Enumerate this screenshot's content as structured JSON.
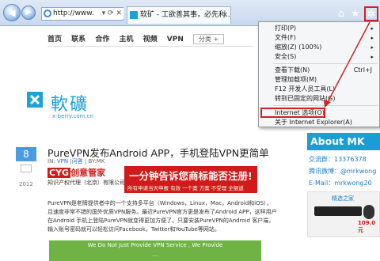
{
  "browser": {
    "address": "http://www.x-be...",
    "address_tools": "▾ ⟳ ✕",
    "tab_title": "软矿 - 工欲善其事，必先利...",
    "tab_close": "×"
  },
  "site": {
    "nav": [
      "首页",
      "联系",
      "合作",
      "主机",
      "视频",
      "VPN"
    ],
    "category_label": "分类 +",
    "logo_name": "軟礦",
    "logo_url": "x-berry.com.cn"
  },
  "post": {
    "day": "8",
    "year": "2012",
    "title": "PureVPN发布Android APP，手机登陆VPN更简单",
    "meta_in": "IN: ",
    "meta_category": "VPN",
    "meta_sep": " |",
    "meta_link2": "问答 ",
    "meta_by": "| BY:MK",
    "body": "PureVPN是老牌提供者中的一个支持多平台（Windows，Linux，Mac，Android和iOS），且速度非常不错的国外优质VPN服务。最近PureVPN官方更是发布了Android APP，这样用户在Android 手机上登陆PureVPN就变得更加方便了。只要安装PureVPN的Android 客户端，输入账号密码就可以轻松访问Facebook，Twitter和YouTube等网站。",
    "banner_line1": "We Do Not Just Provide VPN Service , We Provide",
    "banner_line2": "..."
  },
  "ad": {
    "brand_box": "CYG",
    "brand_rest": "创意管家",
    "org": "知识产权代理（北京）有限公司",
    "headline": "一分钟告诉您商标能否注册!",
    "sub": "所有申请当天申报  有效 一个案 方案  不受理 全额返"
  },
  "sidebar": {
    "about_title": "About MK",
    "qq": "交流群：13376378",
    "weibo": "腾讯微博：@mrkwong",
    "email": "E-Mail：mrkwong20",
    "pic_caption": "精选之家",
    "price": "109.0元"
  },
  "menu": {
    "items": [
      {
        "label": "打印(P)",
        "arrow": "▸"
      },
      {
        "label": "文件(F)",
        "arrow": "▸"
      },
      {
        "label": "缩放(Z) (100%)",
        "arrow": "▸"
      },
      {
        "label": "安全(S)",
        "arrow": "▸"
      },
      {
        "label": "查看下载(N)",
        "shortcut": "Ctrl+J"
      },
      {
        "label": "管理加载项(M)"
      },
      {
        "label": "F12 开发人员工具(L)"
      },
      {
        "label": "转到已固定的网站(G)"
      },
      {
        "label": "Internet 选项(O)"
      },
      {
        "label": "关于 Internet Explorer(A)"
      }
    ]
  },
  "colors": {
    "accent": "#1a9cd6",
    "highlight_border": "#d42020",
    "ad_red": "#d31a1a"
  },
  "icons": [
    "back-icon",
    "forward-icon",
    "ie-logo-icon",
    "home-icon",
    "favorites-star-icon",
    "gear-icon"
  ]
}
